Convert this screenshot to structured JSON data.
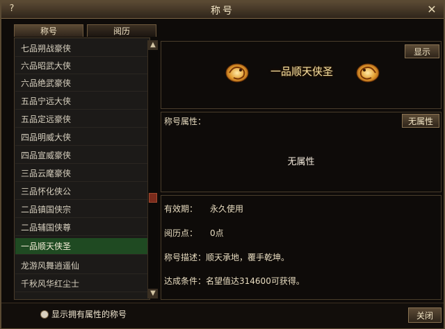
{
  "window": {
    "title": "称号",
    "help_icon": "?",
    "close_icon": "✕"
  },
  "tabs": [
    {
      "label": "称号"
    },
    {
      "label": "阅历"
    }
  ],
  "list": {
    "items": [
      "七品朔战豪侠",
      "六品昭武大侠",
      "六品绝武豪侠",
      "五品宁远大侠",
      "五品定远豪侠",
      "四品明威大侠",
      "四品宣威豪侠",
      "三品云麾豪侠",
      "三品怀化侠公",
      "二品镇国侠宗",
      "二品辅国侠尊",
      "一品顺天侠圣",
      "龙游风舞逍遥仙",
      "千秋风华红尘士"
    ],
    "selected_index": 11
  },
  "scrollbar": {
    "up_icon": "▲",
    "down_icon": "▼"
  },
  "preview": {
    "show_button": "显示",
    "banner_text": "一品顺天侠圣"
  },
  "properties": {
    "label": "称号属性：",
    "button": "无属性",
    "value": "无属性"
  },
  "info": {
    "validity_label": "有效期：",
    "validity_value": "永久使用",
    "exp_label": "阅历点：",
    "exp_value": "0点",
    "desc_label": "称号描述：",
    "desc_value": "顺天承地，覆手乾坤。",
    "cond_label": "达成条件：",
    "cond_value": "名望值达314600可获得。"
  },
  "footer": {
    "checkbox_label": "显示拥有属性的称号",
    "close_button": "关闭"
  },
  "colors": {
    "selected_row": "#1f4a22",
    "banner_gold": "#ffe6a3"
  }
}
